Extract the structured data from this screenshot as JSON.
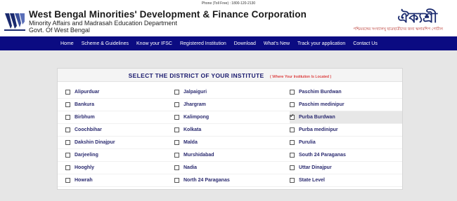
{
  "header": {
    "phone": "Phone (Toll Free) : 1800-120-2130",
    "org_title": "West Bengal Minorities' Development & Finance Corporation",
    "department": "Minority Affairs and Madrasah Education Department",
    "govt": "Govt. Of West Bengal",
    "brand": "ঐক্যশ্রী",
    "brand_subtitle": "পশ্চিমবঙ্গের সংখ্যালঘু ছাত্রছাত্রীদের জন্য স্কলারশিপ পোর্টাল"
  },
  "nav": {
    "items": [
      "Home",
      "Scheme & Guidelines",
      "Know your IFSC",
      "Registered Institution",
      "Download",
      "What's New",
      "Track your application",
      "Contact Us"
    ]
  },
  "district_selector": {
    "title": "SELECT THE DISTRICT OF YOUR INSTITUTE",
    "note": "( Where Your Institution Is Located )",
    "rows": [
      [
        {
          "label": "Alipurduar",
          "checked": false
        },
        {
          "label": "Jalpaiguri",
          "checked": false
        },
        {
          "label": "Paschim Burdwan",
          "checked": false
        }
      ],
      [
        {
          "label": "Bankura",
          "checked": false
        },
        {
          "label": "Jhargram",
          "checked": false
        },
        {
          "label": "Paschim medinipur",
          "checked": false
        }
      ],
      [
        {
          "label": "Birbhum",
          "checked": false
        },
        {
          "label": "Kalimpong",
          "checked": false
        },
        {
          "label": "Purba Burdwan",
          "checked": true
        }
      ],
      [
        {
          "label": "Coochbihar",
          "checked": false
        },
        {
          "label": "Kolkata",
          "checked": false
        },
        {
          "label": "Purba medinipur",
          "checked": false
        }
      ],
      [
        {
          "label": "Dakshin Dinajpur",
          "checked": false
        },
        {
          "label": "Malda",
          "checked": false
        },
        {
          "label": "Purulia",
          "checked": false
        }
      ],
      [
        {
          "label": "Darjeeling",
          "checked": false
        },
        {
          "label": "Murshidabad",
          "checked": false
        },
        {
          "label": "South 24 Paraganas",
          "checked": false
        }
      ],
      [
        {
          "label": "Hooghly",
          "checked": false
        },
        {
          "label": "Nadia",
          "checked": false
        },
        {
          "label": "Uttar Dinajpur",
          "checked": false
        }
      ],
      [
        {
          "label": "Howrah",
          "checked": false
        },
        {
          "label": "North 24 Paraganas",
          "checked": false
        },
        {
          "label": "State Level",
          "checked": false
        }
      ]
    ]
  },
  "colors": {
    "nav_background": "#0b0b82",
    "brand_blue": "#1a2a6e",
    "note_red": "#d40000",
    "page_background": "#e6e6e6"
  }
}
